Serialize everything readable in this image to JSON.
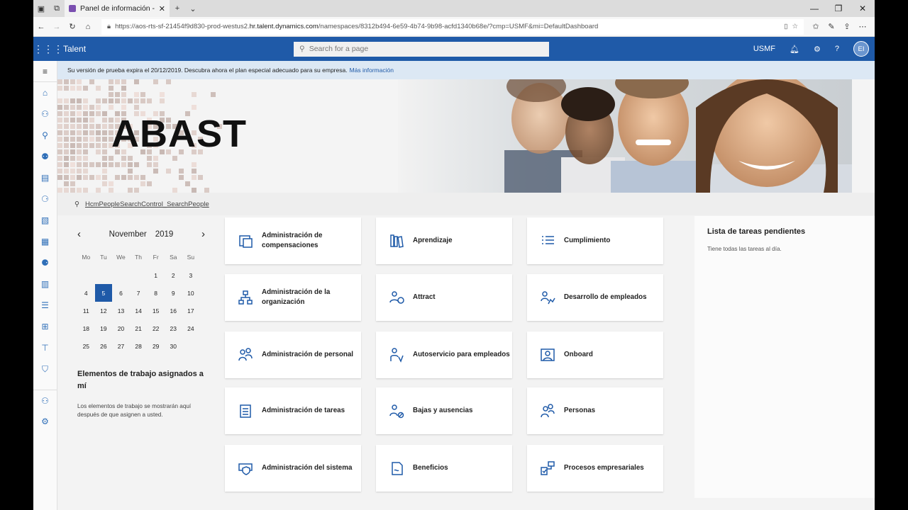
{
  "browser": {
    "tab_title": "Panel de información --",
    "url_prefix": "https://aos-rts-sf-21454f9d830-prod-westus2.",
    "url_host": "hr.talent.dynamics.com",
    "url_rest": "/namespaces/8312b494-6e59-4b74-9b98-acfd1340b68e/?cmp=USMF&mi=DefaultDashboard"
  },
  "app": {
    "name": "Talent",
    "search_placeholder": "Search for a page",
    "company": "USMF",
    "user_initials": "EI"
  },
  "notice": {
    "text": "Su versión de prueba expira el 20/12/2019. Descubra ahora el plan especial adecuado para su empresa.",
    "link": "Más información"
  },
  "banner": {
    "brand": "ABAST"
  },
  "people_search": {
    "text": "HcmPeopleSearchControl_SearchPeople"
  },
  "calendar": {
    "month": "November",
    "year": "2019",
    "prev": "‹",
    "next": "›",
    "dow": [
      "Mo",
      "Tu",
      "We",
      "Th",
      "Fr",
      "Sa",
      "Su"
    ],
    "weeks": [
      [
        "",
        "",
        "",
        "",
        "1",
        "2",
        "3"
      ],
      [
        "4",
        "5",
        "6",
        "7",
        "8",
        "9",
        "10"
      ],
      [
        "11",
        "12",
        "13",
        "14",
        "15",
        "16",
        "17"
      ],
      [
        "18",
        "19",
        "20",
        "21",
        "22",
        "23",
        "24"
      ],
      [
        "25",
        "26",
        "27",
        "28",
        "29",
        "30",
        ""
      ]
    ],
    "today": "5"
  },
  "work_items": {
    "title": "Elementos de trabajo asignados a mí",
    "empty": "Los elementos de trabajo se mostrarán aquí después de que asignen a usted."
  },
  "tiles": [
    {
      "label": "Administración de compensaciones",
      "icon": "compensation-icon"
    },
    {
      "label": "Aprendizaje",
      "icon": "learning-icon"
    },
    {
      "label": "Cumplimiento",
      "icon": "compliance-icon"
    },
    {
      "label": "Administración de la organización",
      "icon": "organization-icon"
    },
    {
      "label": "Attract",
      "icon": "attract-icon"
    },
    {
      "label": "Desarrollo de empleados",
      "icon": "employee-development-icon"
    },
    {
      "label": "Administración de personal",
      "icon": "personnel-icon"
    },
    {
      "label": "Autoservicio para empleados",
      "icon": "self-service-icon"
    },
    {
      "label": "Onboard",
      "icon": "onboard-icon"
    },
    {
      "label": "Administración de tareas",
      "icon": "tasks-icon"
    },
    {
      "label": "Bajas y ausencias",
      "icon": "leave-icon"
    },
    {
      "label": "Personas",
      "icon": "people-icon"
    },
    {
      "label": "Administración del sistema",
      "icon": "system-admin-icon"
    },
    {
      "label": "Beneficios",
      "icon": "benefits-icon"
    },
    {
      "label": "Procesos empresariales",
      "icon": "business-process-icon"
    }
  ],
  "tasks": {
    "title": "Lista de tareas pendientes",
    "empty": "Tiene todas las tareas al día."
  },
  "colors": {
    "accent": "#1f5aa8",
    "notice_bg": "#dce8f4"
  }
}
